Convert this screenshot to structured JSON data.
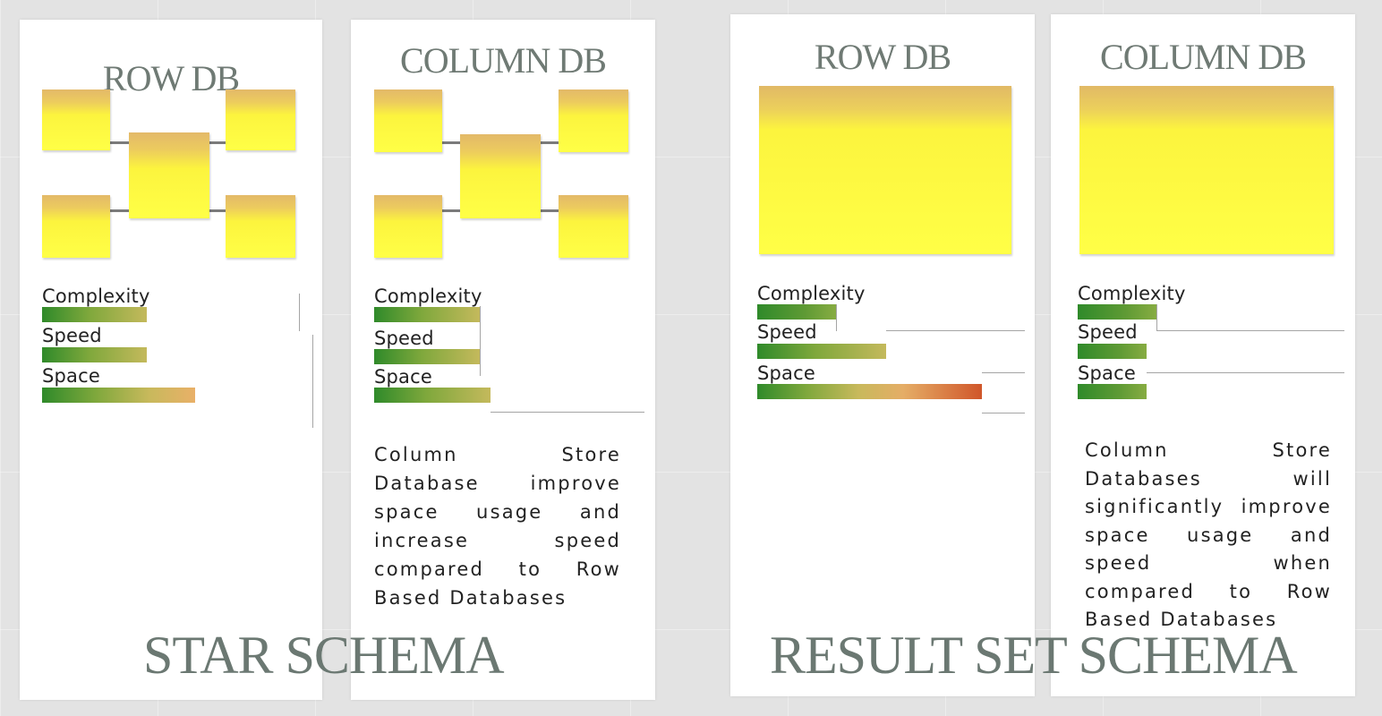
{
  "sections": [
    {
      "title": "STAR SCHEMA",
      "panels": [
        {
          "title": "ROW DB",
          "metrics": [
            {
              "label": "Complexity",
              "level": 0.42
            },
            {
              "label": "Speed",
              "level": 0.42
            },
            {
              "label": "Space",
              "level": 0.62
            }
          ],
          "description": ""
        },
        {
          "title": "COLUMN DB",
          "metrics": [
            {
              "label": "Complexity",
              "level": 0.42
            },
            {
              "label": "Speed",
              "level": 0.42
            },
            {
              "label": "Space",
              "level": 0.47
            }
          ],
          "description": "Column Store Database improve space usage and increase speed compared to Row Based Databases"
        }
      ]
    },
    {
      "title": "RESULT SET SCHEMA",
      "panels": [
        {
          "title": "ROW DB",
          "metrics": [
            {
              "label": "Complexity",
              "level": 0.3
            },
            {
              "label": "Speed",
              "level": 0.5
            },
            {
              "label": "Space",
              "level": 0.88
            }
          ],
          "description": ""
        },
        {
          "title": "COLUMN DB",
          "metrics": [
            {
              "label": "Complexity",
              "level": 0.3
            },
            {
              "label": "Speed",
              "level": 0.27
            },
            {
              "label": "Space",
              "level": 0.27
            }
          ],
          "description": "Column Store Databases will significantly improve space usage and speed when compared to Row Based Databases"
        }
      ]
    }
  ],
  "colors": {
    "background": "#e3e3e3",
    "panel": "#ffffff",
    "box_top": "#e3b969",
    "box_body": "#ffff46",
    "bar_low": "#2f8a2a",
    "bar_high": "#d0562a",
    "title_text": "#6f7a74"
  }
}
